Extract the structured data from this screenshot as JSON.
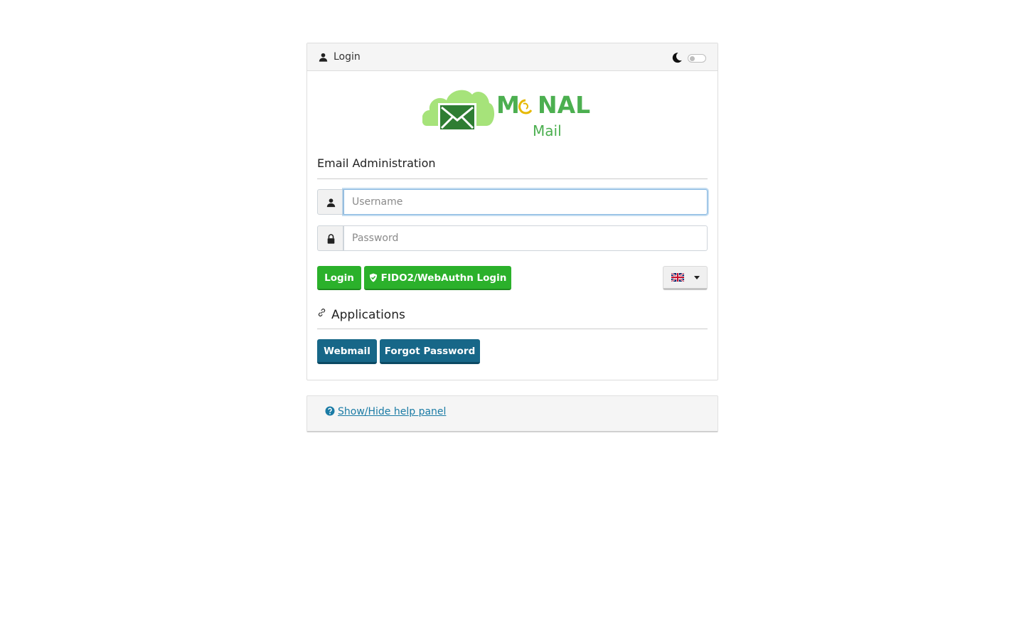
{
  "header": {
    "title": "Login",
    "user_icon": "user-icon",
    "theme_icon": "moon-icon",
    "dark_mode_enabled": false
  },
  "logo": {
    "brand": "MONAL",
    "subtitle": "Mail",
    "colors": {
      "green": "#4caf50",
      "light_green": "#a6e37a",
      "accent": "#e6b800"
    }
  },
  "login_form": {
    "title": "Email Administration",
    "username": {
      "placeholder": "Username",
      "value": "",
      "icon": "user-icon"
    },
    "password": {
      "placeholder": "Password",
      "value": "",
      "icon": "lock-icon"
    },
    "login_label": "Login",
    "fido_label": "FIDO2/WebAuthn Login",
    "language": {
      "selected": "English",
      "flag_icon": "uk-flag-icon"
    }
  },
  "applications": {
    "title": "Applications",
    "icon": "link-icon",
    "buttons": [
      {
        "label": "Webmail"
      },
      {
        "label": "Forgot Password"
      }
    ]
  },
  "help": {
    "label": "Show/Hide help panel",
    "icon": "question-circle-icon"
  },
  "colors": {
    "primary_green": "#2bb12b",
    "primary_blue": "#176788",
    "link": "#1a7ba5"
  }
}
